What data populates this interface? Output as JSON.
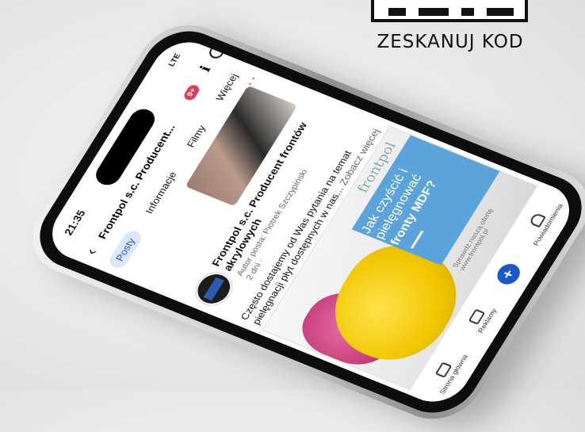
{
  "qr_caption": "ZESKANUJ KOD",
  "status": {
    "time": "21:35",
    "network": "LTE"
  },
  "header": {
    "page_title": "Frontpol s.c. Producent...",
    "badge": "9+"
  },
  "tabs": [
    {
      "label": "Posty",
      "active": true
    },
    {
      "label": "Informacje",
      "active": false
    },
    {
      "label": "Filmy",
      "active": false
    },
    {
      "label": "Więcej",
      "active": false
    }
  ],
  "post": {
    "author_title": "Frontpol s.c. Producent frontów akrylowych",
    "author_line": "Autor posta: Piotrek Szczypiński",
    "time": "2 dni ·",
    "text": "Często dostajemy od Was pytania na temat pielęgnacji płyt dostępnych w nas...",
    "see_more": "Zobacz więcej"
  },
  "ad": {
    "brand": "frontpol",
    "headline": "Jak czyścić i pielęgnować",
    "headline_bold": "fronty MDF?",
    "url_label": "Sprawdź naszą ofertę",
    "url": "www.frontpol.pl"
  },
  "bottom_nav": [
    {
      "label": "Strona główna",
      "icon": "home-icon"
    },
    {
      "label": "Reklamy",
      "icon": "megaphone-icon"
    },
    {
      "label": "",
      "icon": "plus-icon"
    },
    {
      "label": "Powiadomienia",
      "icon": "bell-icon"
    }
  ]
}
